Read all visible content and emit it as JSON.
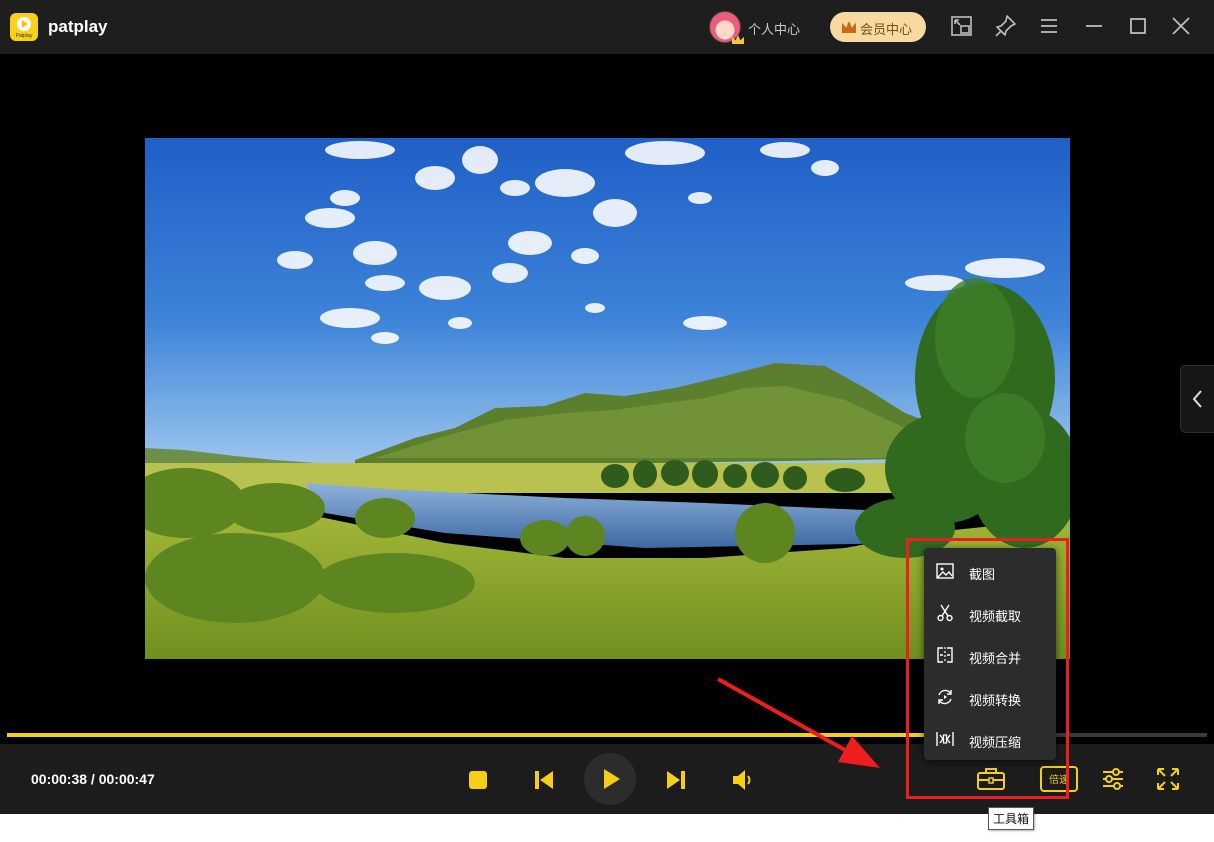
{
  "app": {
    "name": "patplay",
    "logo_text": "Patplay"
  },
  "header": {
    "profile_label": "个人中心",
    "vip_label": "会员中心",
    "icons": [
      "picture-in-picture-icon",
      "pin-icon",
      "menu-icon",
      "minimize-icon",
      "maximize-icon",
      "close-icon"
    ]
  },
  "player": {
    "current_time": "00:00:38",
    "total_time": "00:00:47",
    "time_display": "00:00:38 / 00:00:47",
    "progress_fraction": 0.81,
    "speed_label": "倍速"
  },
  "toolbox_menu": {
    "items": [
      {
        "label": "截图",
        "icon": "screenshot-icon"
      },
      {
        "label": "视频截取",
        "icon": "scissors-icon"
      },
      {
        "label": "视频合并",
        "icon": "merge-icon"
      },
      {
        "label": "视频转换",
        "icon": "convert-icon"
      },
      {
        "label": "视频压缩",
        "icon": "compress-icon"
      }
    ]
  },
  "tooltip": {
    "text": "工具箱"
  },
  "colors": {
    "accent": "#f5cf15",
    "annotation": "#ef1d1d",
    "titlebar": "#1e1e1e",
    "controlbar": "#1c1c1c"
  }
}
